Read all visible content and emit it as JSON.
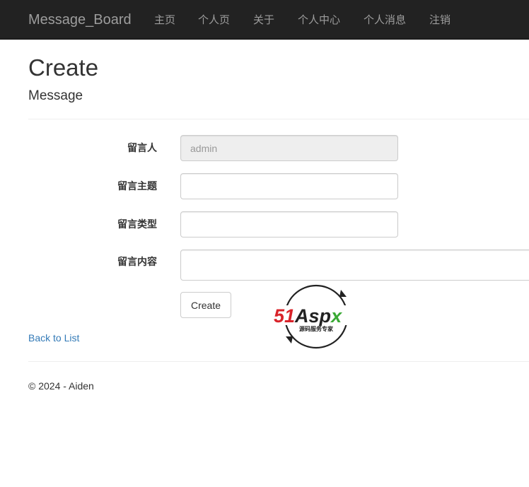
{
  "navbar": {
    "brand": "Message_Board",
    "items": [
      {
        "label": "主页"
      },
      {
        "label": "个人页"
      },
      {
        "label": "关于"
      },
      {
        "label": "个人中心"
      },
      {
        "label": "个人消息"
      },
      {
        "label": "注销"
      }
    ]
  },
  "page": {
    "title": "Create",
    "subtitle": "Message"
  },
  "form": {
    "author": {
      "label": "留言人",
      "value": "admin"
    },
    "subject": {
      "label": "留言主题",
      "value": ""
    },
    "type": {
      "label": "留言类型",
      "value": ""
    },
    "content": {
      "label": "留言内容",
      "value": ""
    },
    "submit_label": "Create"
  },
  "back_link": "Back to List",
  "footer": "© 2024 - Aiden",
  "watermark": {
    "brand_red": "51",
    "brand_dark": "Asp",
    "brand_green": "x",
    "tagline": "源码服务专家",
    "colors": {
      "red": "#d9232a",
      "dark": "#222222",
      "green": "#3aa935"
    }
  }
}
